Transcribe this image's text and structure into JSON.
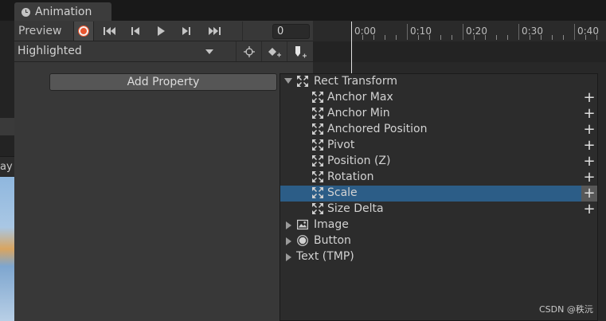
{
  "background_editor": {
    "game_tab_fragment": "ay"
  },
  "window": {
    "tab_title": "Animation"
  },
  "toolbar": {
    "preview_label": "Preview",
    "frame_value": "0",
    "clip_selected": "Highlighted"
  },
  "timeline": {
    "ticks": [
      "0:00",
      "0:10",
      "0:20",
      "0:30",
      "0:40"
    ]
  },
  "add_property_label": "Add Property",
  "properties": {
    "rect_transform": {
      "label": "Rect Transform",
      "children": [
        {
          "label": "Anchor Max",
          "selected": false
        },
        {
          "label": "Anchor Min",
          "selected": false
        },
        {
          "label": "Anchored Position",
          "selected": false
        },
        {
          "label": "Pivot",
          "selected": false
        },
        {
          "label": "Position (Z)",
          "selected": false
        },
        {
          "label": "Rotation",
          "selected": false
        },
        {
          "label": "Scale",
          "selected": true
        },
        {
          "label": "Size Delta",
          "selected": false
        }
      ]
    },
    "image": {
      "label": "Image"
    },
    "button": {
      "label": "Button"
    },
    "text_tmp": {
      "label": "Text (TMP)"
    }
  },
  "add_symbol": "+",
  "watermark": "CSDN @秩沅",
  "colors": {
    "selection": "#2c5d87",
    "record": "#e8552f",
    "panel": "#383838"
  },
  "icons": {
    "tab": "clock-icon",
    "record": "record-icon",
    "transport": [
      "first-key-icon",
      "prev-key-icon",
      "play-icon",
      "next-key-icon",
      "last-key-icon"
    ],
    "key_tools": [
      "filter-by-selection-icon",
      "add-keyframe-icon",
      "add-event-icon"
    ],
    "rect_transform": "rect-transform-icon",
    "image": "image-icon",
    "button": "button-icon"
  }
}
